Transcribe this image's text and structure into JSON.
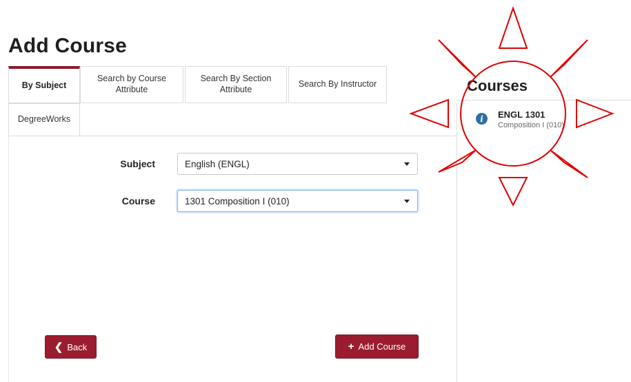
{
  "page": {
    "title": "Add Course"
  },
  "tabs": [
    {
      "label": "By Subject",
      "active": true
    },
    {
      "label": "Search by Course Attribute",
      "active": false
    },
    {
      "label": "Search By Section Attribute",
      "active": false
    },
    {
      "label": "Search By Instructor",
      "active": false
    },
    {
      "label": "DegreeWorks",
      "active": false
    }
  ],
  "form": {
    "subject": {
      "label": "Subject",
      "value": "English (ENGL)"
    },
    "course": {
      "label": "Course",
      "value": "1301 Composition I (010)"
    }
  },
  "buttons": {
    "back_label": "Back",
    "add_label": "Add Course"
  },
  "courses_panel": {
    "title": "Courses",
    "items": [
      {
        "code": "ENGL 1301",
        "description": "Composition I (010)",
        "icon": "info-icon"
      }
    ]
  },
  "colors": {
    "accent": "#9b1c2f",
    "annotation": "#e00000",
    "info_icon": "#2f6fa5"
  }
}
